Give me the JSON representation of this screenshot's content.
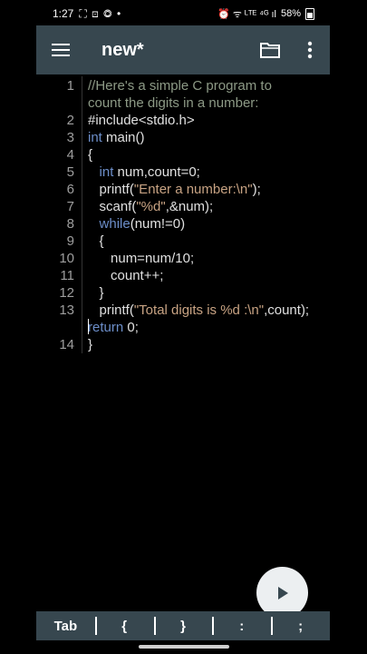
{
  "status_bar": {
    "time": "1:27",
    "notif_icons": "⛶ ⊡ ◎ •",
    "signal_icons": "⏰ ᯤ ᴸᵀᴱ ⁴ᴳ ıl",
    "battery": "58%"
  },
  "toolbar": {
    "title": "new*",
    "menu_icon": "hamburger-icon",
    "folder_icon": "folder-icon",
    "more_icon": "more-vert-icon"
  },
  "editor": {
    "lines": [
      {
        "num": "1",
        "segments": [
          {
            "t": "//Here's a simple C program to",
            "c": "cmt"
          }
        ]
      },
      {
        "num": "",
        "segments": [
          {
            "t": "count the digits in a number:",
            "c": "cmt"
          }
        ]
      },
      {
        "num": "2",
        "segments": [
          {
            "t": "#include<stdio.h>",
            "c": "pp"
          }
        ]
      },
      {
        "num": "3",
        "segments": [
          {
            "t": "int",
            "c": "kw"
          },
          {
            "t": " main()",
            "c": ""
          }
        ]
      },
      {
        "num": "4",
        "segments": [
          {
            "t": "{",
            "c": ""
          }
        ]
      },
      {
        "num": "5",
        "segments": [
          {
            "t": "   ",
            "c": ""
          },
          {
            "t": "int",
            "c": "kw"
          },
          {
            "t": " num,count=0;",
            "c": ""
          }
        ]
      },
      {
        "num": "6",
        "segments": [
          {
            "t": "   printf(",
            "c": ""
          },
          {
            "t": "\"Enter a number:\\n\"",
            "c": "str"
          },
          {
            "t": ");",
            "c": ""
          }
        ]
      },
      {
        "num": "7",
        "segments": [
          {
            "t": "   scanf(",
            "c": ""
          },
          {
            "t": "\"%d\"",
            "c": "str"
          },
          {
            "t": ",&num);",
            "c": ""
          }
        ]
      },
      {
        "num": "8",
        "segments": [
          {
            "t": "   ",
            "c": ""
          },
          {
            "t": "while",
            "c": "kw"
          },
          {
            "t": "(num!=0)",
            "c": ""
          }
        ]
      },
      {
        "num": "9",
        "segments": [
          {
            "t": "   {",
            "c": ""
          }
        ]
      },
      {
        "num": "10",
        "segments": [
          {
            "t": "      num=num/10;",
            "c": ""
          }
        ]
      },
      {
        "num": "11",
        "segments": [
          {
            "t": "      count++;",
            "c": ""
          }
        ]
      },
      {
        "num": "12",
        "segments": [
          {
            "t": "   }",
            "c": ""
          }
        ]
      },
      {
        "num": "13",
        "segments": [
          {
            "t": "   printf(",
            "c": ""
          },
          {
            "t": "\"Total digits is %d :\\n\"",
            "c": "str"
          },
          {
            "t": ",count);",
            "c": ""
          }
        ]
      },
      {
        "num": "",
        "segments": [
          {
            "t": "return",
            "c": "kw cursor-before"
          },
          {
            "t": " 0;",
            "c": ""
          }
        ]
      },
      {
        "num": "14",
        "segments": [
          {
            "t": "}",
            "c": ""
          }
        ]
      }
    ]
  },
  "run_button": {
    "icon": "play-icon"
  },
  "symbols": [
    "Tab",
    "{",
    "}",
    ":",
    ";"
  ],
  "colors": {
    "toolbar": "#37474f",
    "comment": "#8d9a86",
    "keyword": "#6c8ec9",
    "string": "#c8a383"
  }
}
